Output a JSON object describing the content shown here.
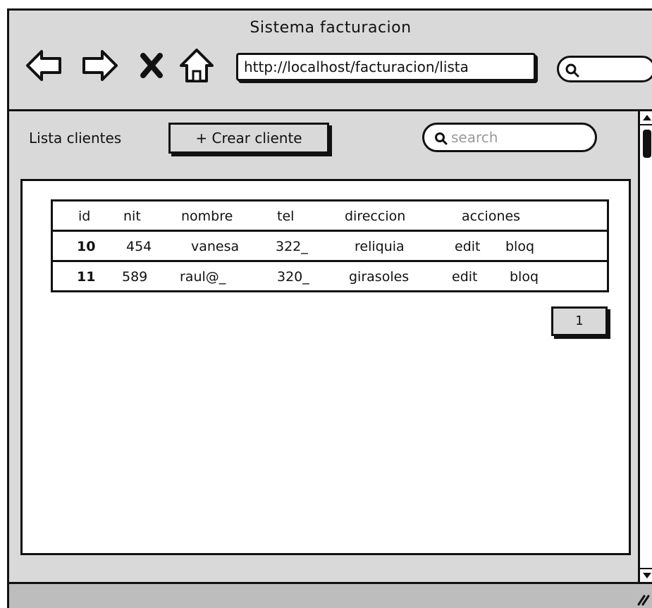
{
  "window": {
    "title": "Sistema facturacion"
  },
  "browser": {
    "url": "http://localhost/facturacion/lista",
    "nav_icons": [
      "back-arrow-icon",
      "forward-arrow-icon",
      "stop-icon",
      "home-icon"
    ]
  },
  "page": {
    "label": "Lista clientes",
    "create_button": "+ Crear cliente",
    "search_placeholder": "search"
  },
  "table": {
    "headers": [
      "id",
      "nit",
      "nombre",
      "tel",
      "direccion",
      "acciones"
    ],
    "rows": [
      {
        "id": "10",
        "nit": "454",
        "nombre": "vanesa",
        "tel": "322_",
        "direccion": "reliquia",
        "edit": "edit",
        "bloq": "bloq"
      },
      {
        "id": "11",
        "nit": "589",
        "nombre": "raul@_",
        "tel": "320_",
        "direccion": "girasoles",
        "edit": "edit",
        "bloq": "bloq"
      }
    ]
  },
  "pagination": {
    "current_page": "1"
  }
}
